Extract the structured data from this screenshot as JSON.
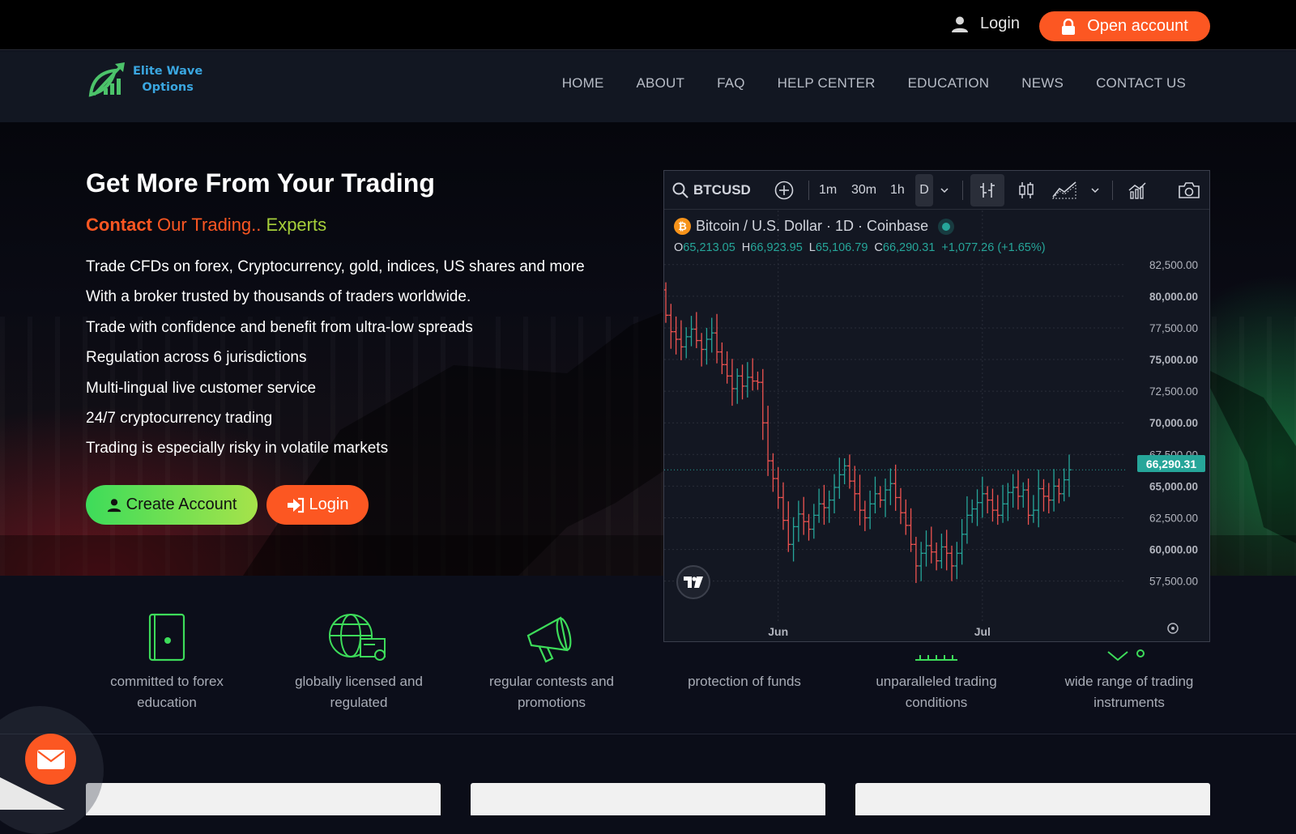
{
  "topbar": {
    "login_label": "Login",
    "open_account_label": "Open account"
  },
  "brand": {
    "name_line1": "Elite Wave",
    "name_line2": "Options"
  },
  "nav": {
    "items": [
      "HOME",
      "ABOUT",
      "FAQ",
      "HELP CENTER",
      "EDUCATION",
      "NEWS",
      "CONTACT US"
    ]
  },
  "hero": {
    "title": "Get More From Your Trading",
    "tagline_1": "Contact",
    "tagline_2": " Our Trading..",
    "tagline_3": " Experts",
    "features": [
      "Trade CFDs on forex, Cryptocurrency, gold, indices, US shares and more",
      "With a broker trusted by thousands of traders worldwide.",
      "Trade with confidence and benefit from ultra-low spreads",
      "Regulation across 6 jurisdictions",
      "Multi-lingual live customer service",
      "24/7 cryptocurrency trading",
      "Trading is especially risky in volatile markets"
    ],
    "create_account_label": "Create Account",
    "login_label": "Login"
  },
  "benefits": [
    {
      "label": "committed to forex education",
      "icon": "book-icon"
    },
    {
      "label": "globally licensed and regulated",
      "icon": "globe-license-icon"
    },
    {
      "label": "regular contests and promotions",
      "icon": "megaphone-icon"
    },
    {
      "label": "protection of funds",
      "icon": "shield-icon"
    },
    {
      "label": "unparalleled trading conditions",
      "icon": "chart-icon"
    },
    {
      "label": "wide range of trading instruments",
      "icon": "instruments-icon"
    }
  ],
  "colors": {
    "accent": "#fc5722",
    "green": "#3ddc5a",
    "up": "#26a69a",
    "down": "#ef5350"
  },
  "chart_widget": {
    "symbol": "BTCUSD",
    "intervals": [
      "1m",
      "30m",
      "1h",
      "D"
    ],
    "selected_interval": "D",
    "legend_title": "Bitcoin / U.S. Dollar · 1D · Coinbase",
    "ohlc": {
      "o_label": "O",
      "o": "65,213.05",
      "h_label": "H",
      "h": "66,923.95",
      "l_label": "L",
      "l": "65,106.79",
      "c_label": "C",
      "c": "66,290.31",
      "change": "+1,077.26 (+1.65%)"
    },
    "last_price": "66,290.31"
  },
  "chart_data": {
    "type": "ohlc",
    "title": "Bitcoin / U.S. Dollar · 1D · Coinbase",
    "y_ticks": [
      "82,500.00",
      "80,000.00",
      "77,500.00",
      "75,000.00",
      "72,500.00",
      "70,000.00",
      "67,500.00",
      "65,000.00",
      "62,500.00",
      "60,000.00",
      "57,500.00"
    ],
    "y_tick_values": [
      82500,
      80000,
      77500,
      75000,
      72500,
      70000,
      67500,
      65000,
      62500,
      60000,
      57500
    ],
    "x_ticks": [
      "Jun",
      "Jul"
    ],
    "x_tick_bar_index": [
      22,
      62
    ],
    "ylim": [
      56000,
      84000
    ],
    "closes": [
      78500,
      77200,
      76600,
      76000,
      76800,
      77400,
      76500,
      75800,
      76600,
      77100,
      75600,
      74600,
      73700,
      72700,
      73700,
      72900,
      73600,
      73300,
      73200,
      70000,
      67000,
      65600,
      64100,
      62300,
      60400,
      61800,
      62800,
      62200,
      61600,
      62700,
      63600,
      63300,
      63900,
      64900,
      65900,
      66600,
      65400,
      64400,
      63100,
      62500,
      63600,
      64400,
      63900,
      64700,
      65200,
      64100,
      62900,
      61900,
      60400,
      58700,
      59700,
      60300,
      59800,
      59100,
      60200,
      59700,
      58700,
      59700,
      61200,
      62700,
      63200,
      63700,
      64400,
      63900,
      63100,
      62700,
      63600,
      64500,
      64900,
      64200,
      64700,
      62700,
      63100,
      64800,
      64200,
      63900,
      65000,
      64400,
      65500,
      66290
    ]
  }
}
